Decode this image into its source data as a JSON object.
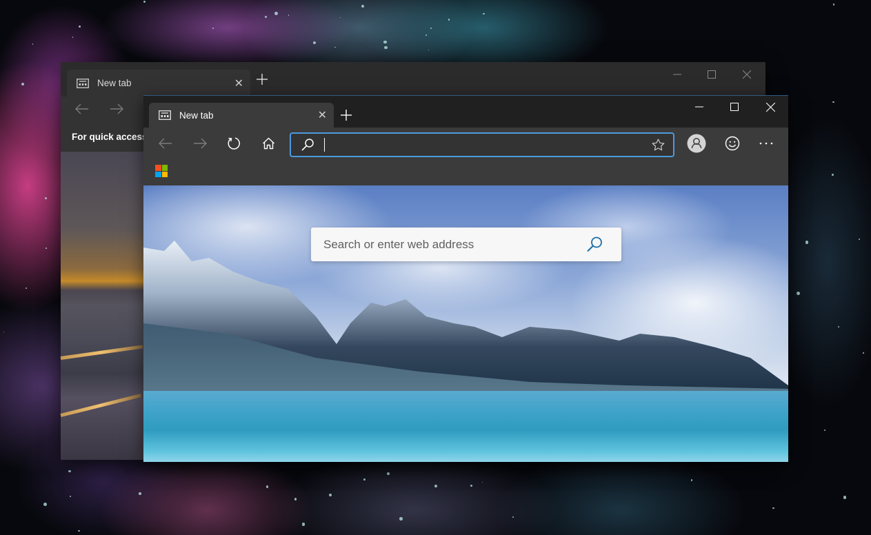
{
  "desktop": {
    "wallpaper": "colorful powder explosion on black"
  },
  "back_window": {
    "tab": {
      "title": "New tab",
      "icon": "new-tab-page-icon",
      "close_icon": "close-icon"
    },
    "new_tab_icon": "plus-icon",
    "caption": {
      "minimize_icon": "minimize-icon",
      "maximize_icon": "maximize-icon",
      "close_icon": "close-icon"
    },
    "nav": {
      "back_icon": "arrow-left-icon",
      "forward_icon": "arrow-right-icon"
    },
    "quick_access_text": "For quick access,"
  },
  "front_window": {
    "tab": {
      "title": "New tab",
      "icon": "new-tab-page-icon",
      "close_icon": "close-icon"
    },
    "new_tab_icon": "plus-icon",
    "caption": {
      "minimize_icon": "minimize-icon",
      "maximize_icon": "maximize-icon",
      "close_icon": "close-icon"
    },
    "nav": {
      "back_icon": "arrow-left-icon",
      "forward_icon": "arrow-right-icon",
      "refresh_icon": "refresh-icon",
      "home_icon": "home-icon"
    },
    "address_bar": {
      "value": "",
      "placeholder": "",
      "search_icon": "search-icon",
      "favorite_icon": "star-icon"
    },
    "toolbar": {
      "profile_icon": "profile-icon",
      "feedback_icon": "smiley-icon",
      "menu_icon": "more-horizontal-icon"
    },
    "favorites_bar": {
      "microsoft_logo": "microsoft-logo",
      "logo_colors": [
        "#f25022",
        "#7fba00",
        "#00a4ef",
        "#ffb900"
      ]
    },
    "new_tab_page": {
      "search_placeholder": "Search or enter web address",
      "search_value": "",
      "search_icon": "search-icon"
    }
  },
  "colors": {
    "accent": "#4d9ae0",
    "titlebar": "#202020",
    "toolbar": "#3b3b3b"
  }
}
